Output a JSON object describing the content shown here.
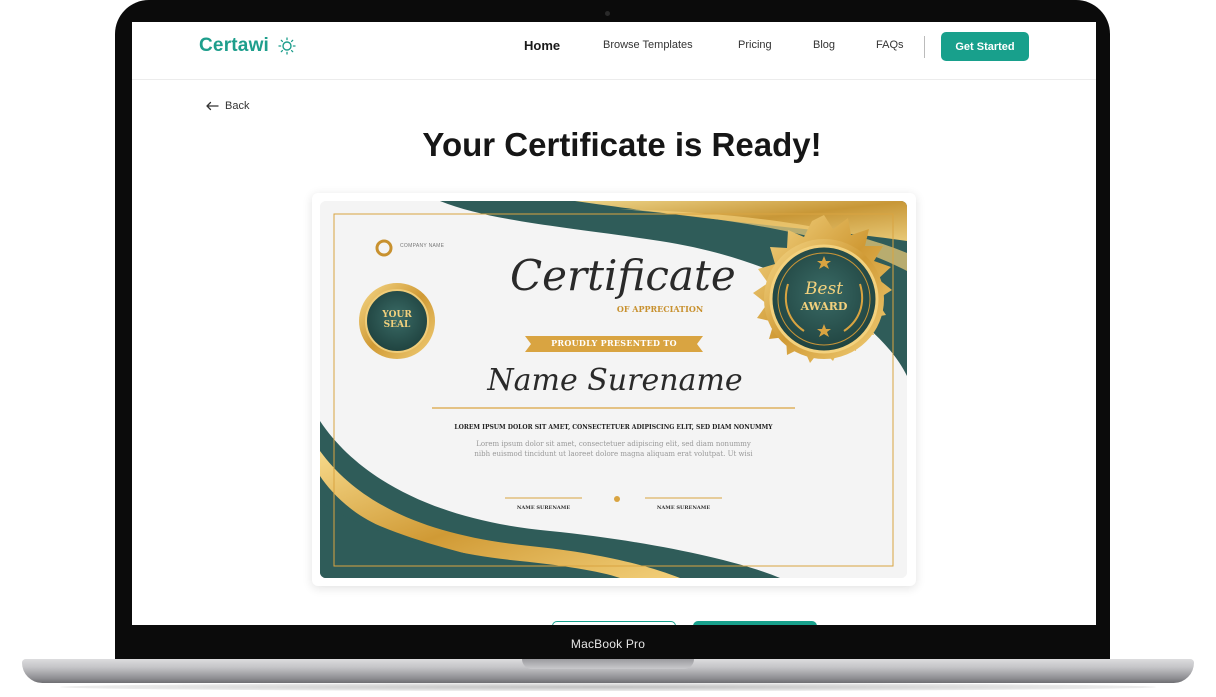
{
  "device": {
    "label": "MacBook Pro"
  },
  "nav": {
    "logo_main": "Certa",
    "logo_accent": "wi",
    "links": [
      "Home",
      "Browse Templates",
      "Pricing",
      "Blog",
      "FAQs"
    ],
    "cta": "Get Started"
  },
  "page": {
    "back_label": "Back",
    "title": "Your Certificate is Ready!"
  },
  "certificate": {
    "company_name": "COMPANY NAME",
    "heading": "Certificate",
    "subheading": "OF APPRECIATION",
    "presented": "PROUDLY PRESENTED TO",
    "recipient": "Name Surename",
    "body_bold": "LOREM IPSUM DOLOR SIT AMET, CONSECTETUER ADIPISCING ELIT, SED DIAM NONUMMY",
    "body_line1": "Lorem ipsum dolor sit amet, consectetuer adipiscing elit, sed diam nonummy",
    "body_line2": "nibh euismod tincidunt ut laoreet dolore magna aliquam erat volutpat. Ut wisi",
    "seal_line1": "YOUR",
    "seal_line2": "SEAL",
    "badge_line1": "Best",
    "badge_line2": "AWARD",
    "signature_left": "NAME SURENAME",
    "signature_right": "NAME SURENAME"
  },
  "colors": {
    "brand": "#18a08c",
    "brand_accent": "#a02ea8",
    "cert_green": "#2f5c59",
    "cert_gold": "#d9a441"
  }
}
